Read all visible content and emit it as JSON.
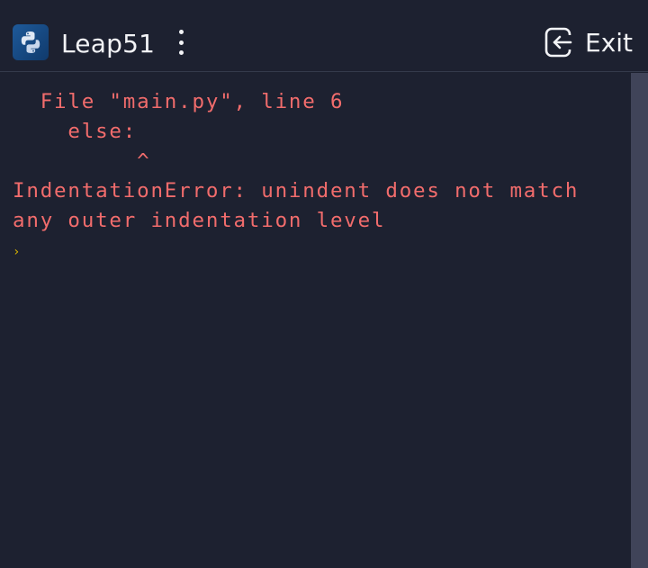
{
  "header": {
    "app_name": "Leap51",
    "exit_label": "Exit",
    "app_icon": "python-logo-icon",
    "menu_icon": "kebab-menu-icon",
    "exit_icon": "exit-icon",
    "app_icon_color": "#1e5a9a"
  },
  "console": {
    "lines": [
      "  File \"main.py\", line 6",
      "    else:",
      "         ^",
      "IndentationError: unindent does not match",
      "any outer indentation level"
    ],
    "prompt_symbol": "›",
    "error_color": "#f16c6c",
    "prompt_color": "#d6b200"
  }
}
